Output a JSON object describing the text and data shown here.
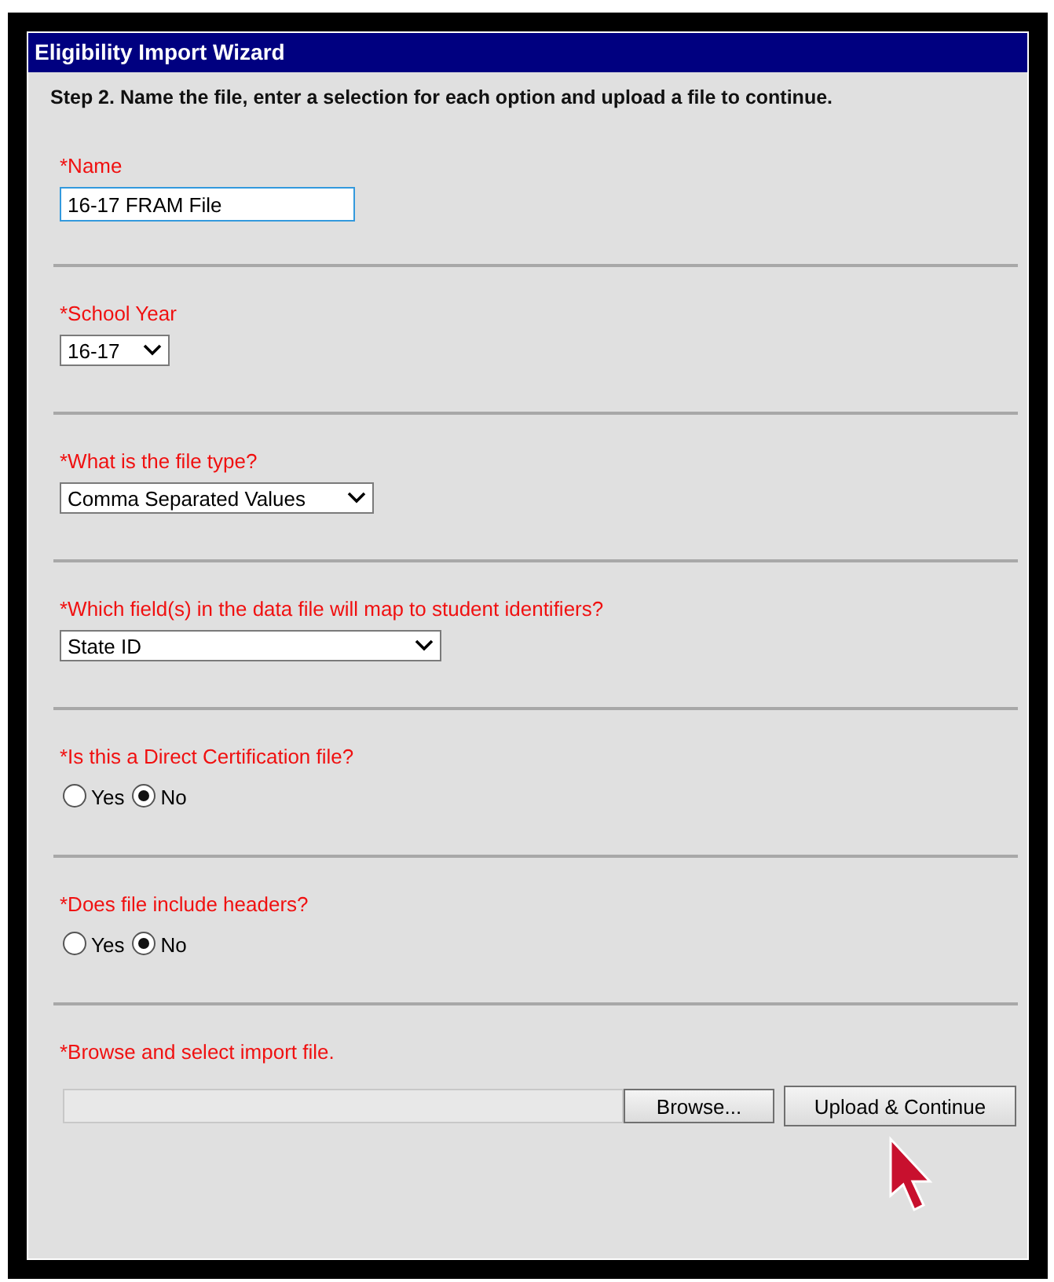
{
  "window": {
    "title": "Eligibility Import Wizard"
  },
  "instructions": "Step 2. Name the file, enter a selection for each option and upload a file to continue.",
  "sections": [
    {
      "kind": "text",
      "label": "*Name",
      "value": "16-17 FRAM File",
      "focused": true
    },
    {
      "kind": "select",
      "label": "*School Year",
      "value": "16-17"
    },
    {
      "kind": "select",
      "label": "*What is the file type?",
      "value": "Comma Separated Values"
    },
    {
      "kind": "select",
      "label": "*Which field(s) in the data file will map to student identifiers?",
      "value": "State ID"
    },
    {
      "kind": "radio",
      "label": "*Is this a Direct Certification file?",
      "options": [
        {
          "label": "Yes",
          "selected": false
        },
        {
          "label": "No",
          "selected": true
        }
      ]
    },
    {
      "kind": "radio",
      "label": "*Does file include headers?",
      "options": [
        {
          "label": "Yes",
          "selected": false
        },
        {
          "label": "No",
          "selected": true
        }
      ]
    },
    {
      "kind": "file",
      "label": "*Browse and select import file.",
      "browse": "Browse...",
      "submit": "Upload & Continue"
    }
  ]
}
